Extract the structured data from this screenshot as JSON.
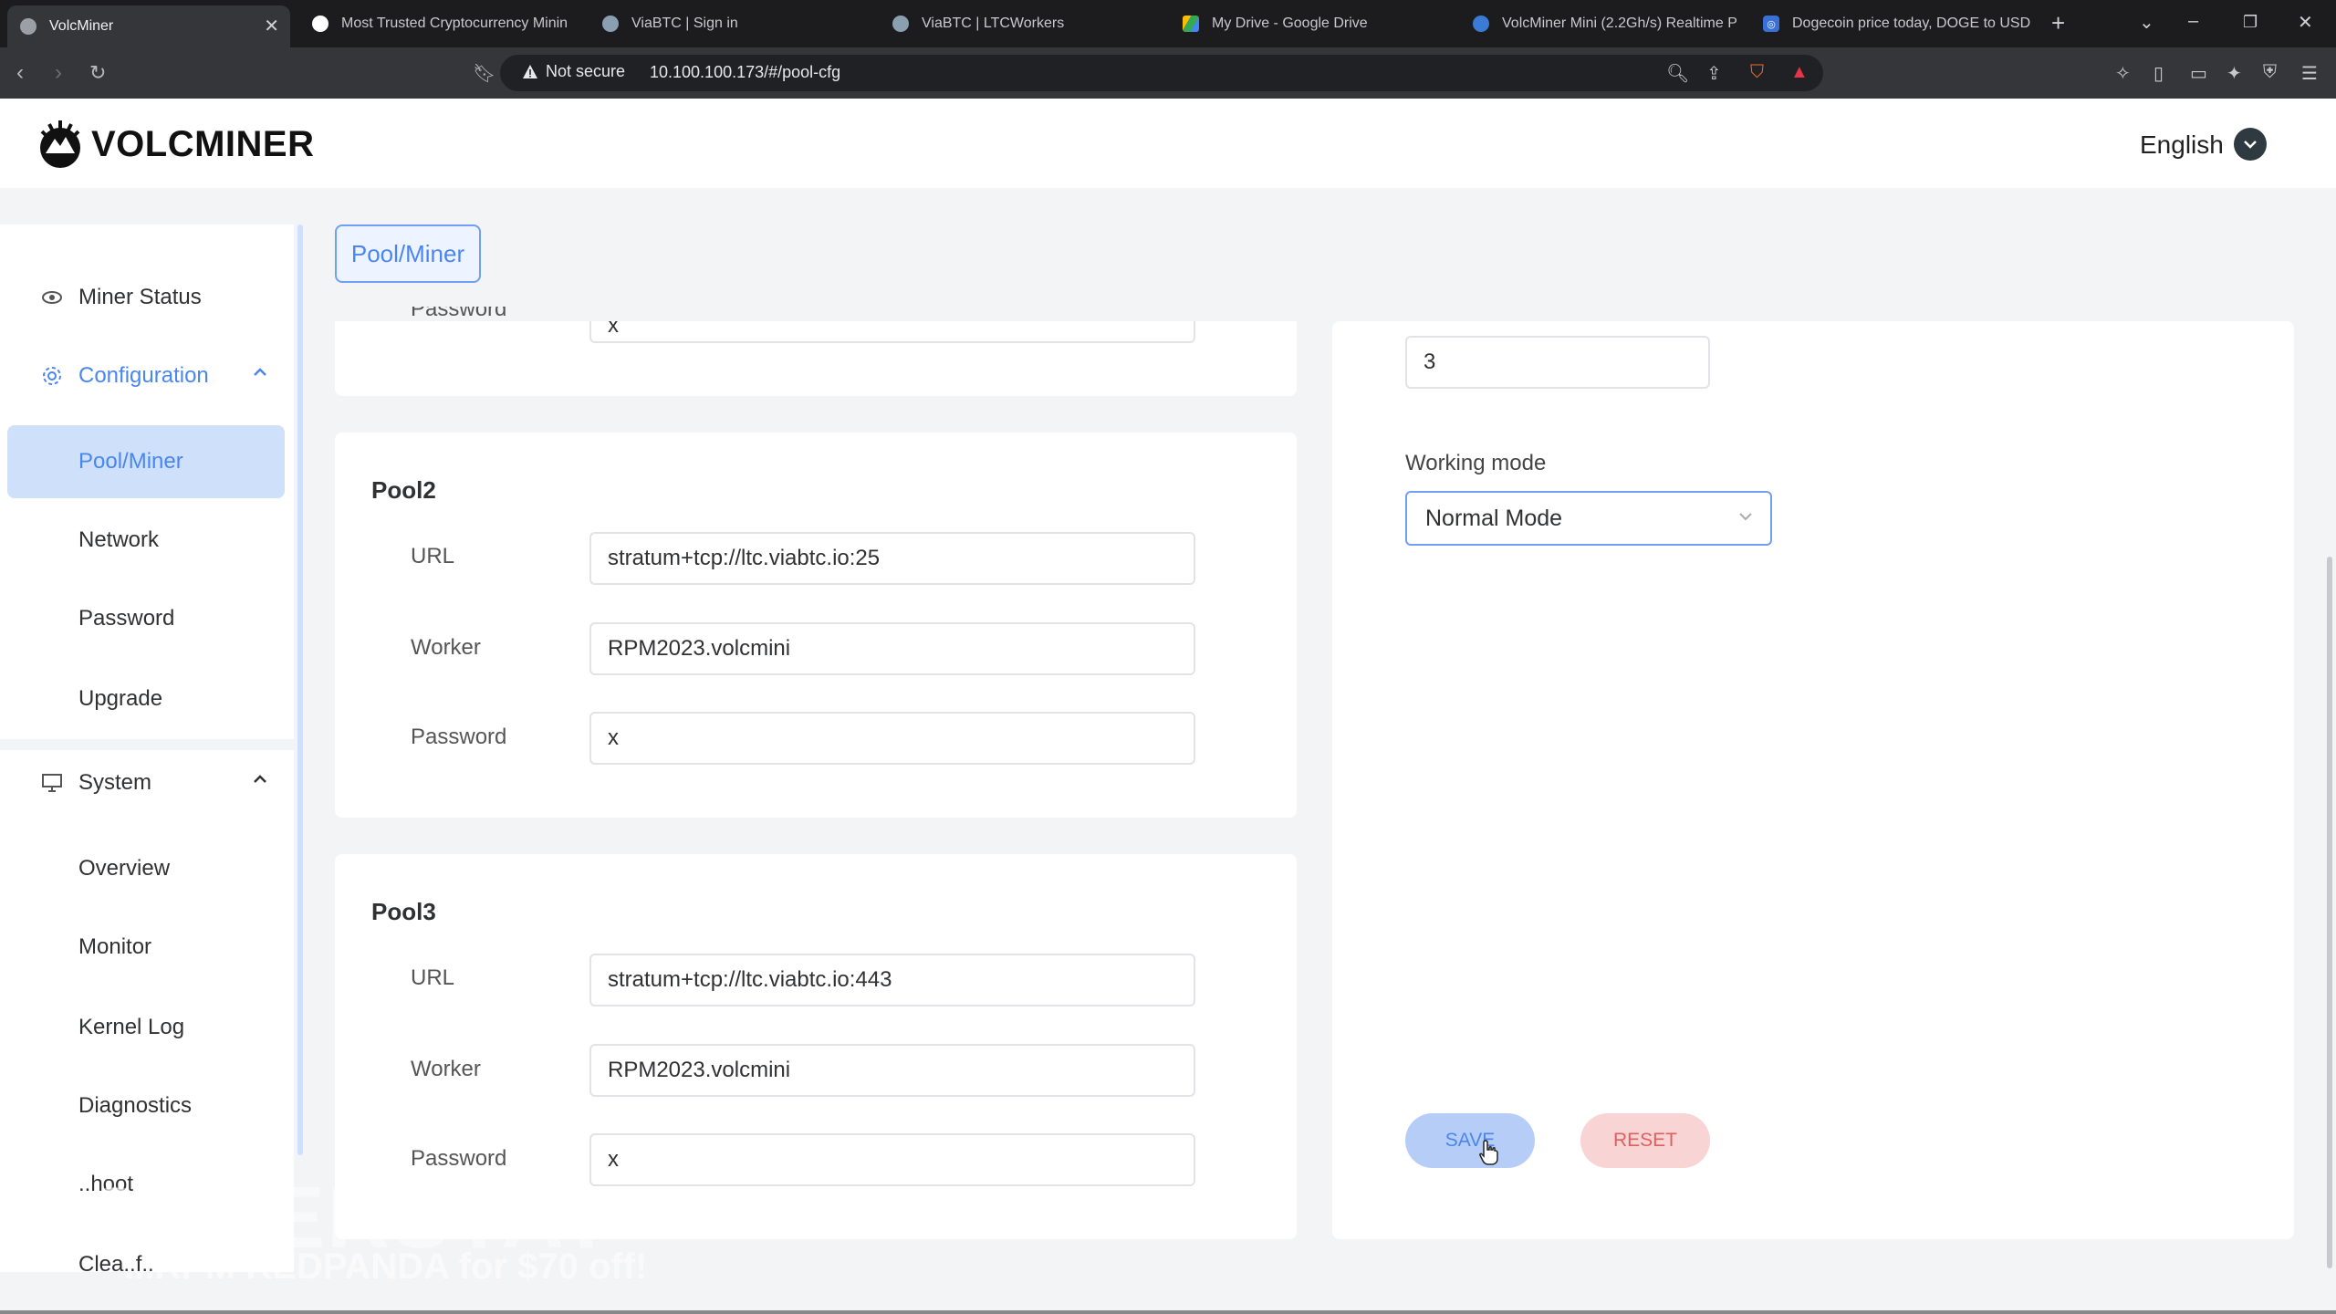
{
  "browser": {
    "tabs": [
      {
        "label": "VolcMiner",
        "active": true
      },
      {
        "label": "Most Trusted Cryptocurrency Minin"
      },
      {
        "label": "ViaBTC | Sign in"
      },
      {
        "label": "ViaBTC | LTCWorkers"
      },
      {
        "label": "My Drive - Google Drive"
      },
      {
        "label": "VolcMiner Mini (2.2Gh/s) Realtime P"
      },
      {
        "label": "Dogecoin price today, DOGE to USD"
      }
    ],
    "security_label": "Not secure",
    "url": "10.100.100.173/#/pool-cfg"
  },
  "header": {
    "logo_text": "VOLCMINER",
    "language": "English"
  },
  "sidebar": {
    "miner_status": "Miner Status",
    "configuration": "Configuration",
    "config_items": [
      "Pool/Miner",
      "Network",
      "Password",
      "Upgrade"
    ],
    "system": "System",
    "system_items": [
      "Overview",
      "Monitor",
      "Kernel Log",
      "Diagnostics",
      "..hoot",
      "Clea..f.."
    ]
  },
  "tab_chip": "Pool/Miner",
  "pool1": {
    "password_label": "Password",
    "password_value": "x"
  },
  "pool2": {
    "title": "Pool2",
    "url_label": "URL",
    "url": "stratum+tcp://ltc.viabtc.io:25",
    "worker_label": "Worker",
    "worker": "RPM2023.volcmini",
    "password_label": "Password",
    "password": "x"
  },
  "pool3": {
    "title": "Pool3",
    "url_label": "URL",
    "url": "stratum+tcp://ltc.viabtc.io:443",
    "worker_label": "Worker",
    "worker": "RPM2023.volcmini",
    "password_label": "Password",
    "password": "x"
  },
  "settings": {
    "top_value": "3",
    "working_mode_label": "Working mode",
    "working_mode": "Normal Mode",
    "save_label": "SAVE",
    "reset_label": "RESET"
  },
  "watermark": {
    "brand": "MINERSTAT",
    "promo": "...RPM REDPANDA for $70 off!"
  },
  "colors": {
    "accent": "#4a86f0",
    "selected_bg": "#cfe0fb",
    "reset": "#e06060"
  }
}
